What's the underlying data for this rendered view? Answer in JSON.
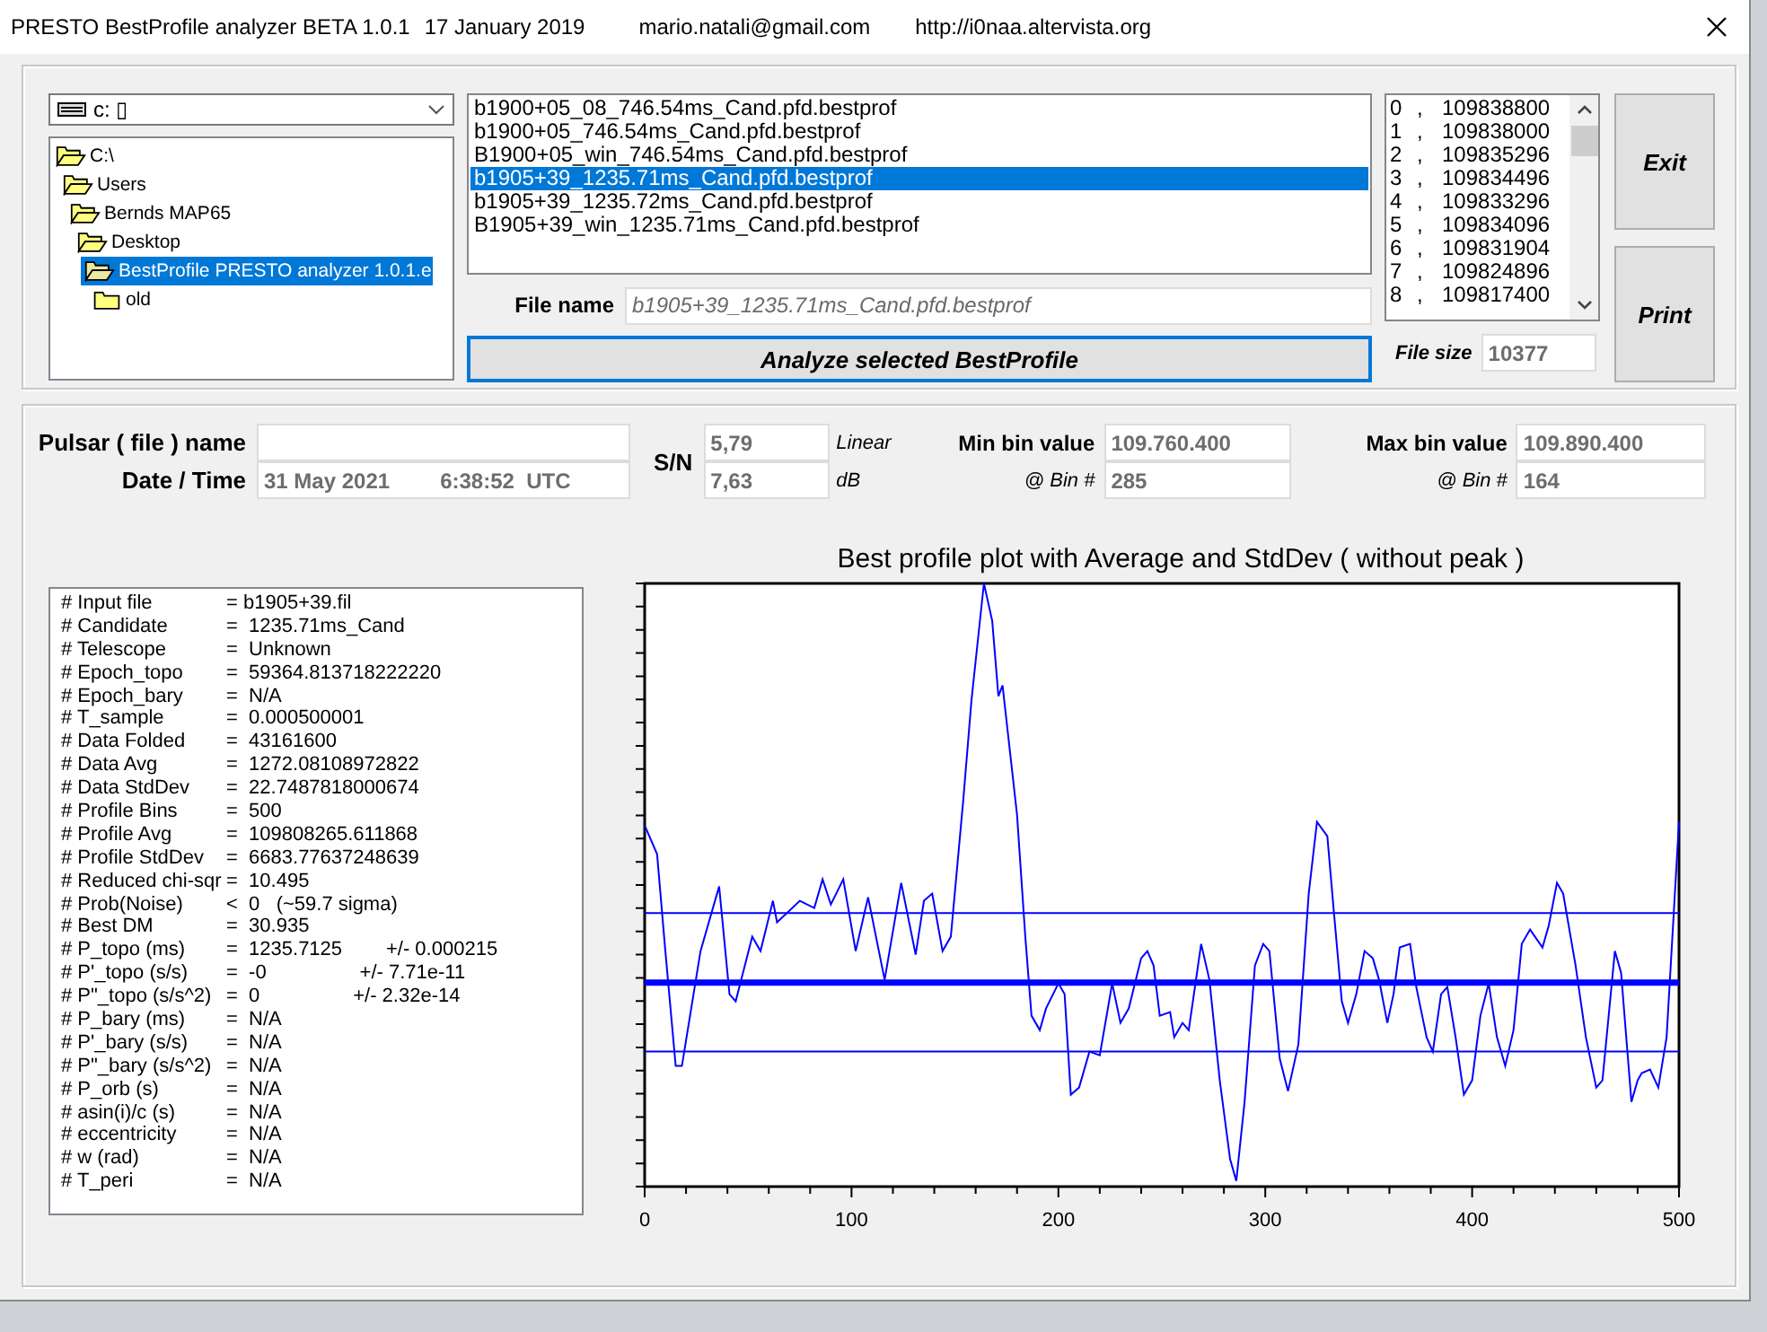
{
  "window": {
    "title": "PRESTO BestProfile analyzer BETA 1.0.1",
    "date": "17 January 2019",
    "email": "mario.natali@gmail.com",
    "url": "http://i0naa.altervista.org"
  },
  "drive_combo": {
    "value": "c: ▯"
  },
  "folder_tree": [
    {
      "label": "C:\\",
      "expanded": true,
      "selected": false,
      "children": [
        {
          "label": "Users",
          "expanded": true,
          "selected": false,
          "children": [
            {
              "label": "Bernds MAP65",
              "expanded": true,
              "selected": false,
              "children": [
                {
                  "label": "Desktop",
                  "expanded": true,
                  "selected": false,
                  "children": [
                    {
                      "label": "BestProfile PRESTO analyzer 1.0.1.e",
                      "expanded": true,
                      "selected": true,
                      "children": [
                        {
                          "label": "old",
                          "expanded": false,
                          "selected": false
                        }
                      ]
                    }
                  ]
                }
              ]
            }
          ]
        }
      ]
    }
  ],
  "file_list": [
    {
      "label": "b1900+05_08_746.54ms_Cand.pfd.bestprof",
      "selected": false
    },
    {
      "label": "b1900+05_746.54ms_Cand.pfd.bestprof",
      "selected": false
    },
    {
      "label": "B1900+05_win_746.54ms_Cand.pfd.bestprof",
      "selected": false
    },
    {
      "label": "b1905+39_1235.71ms_Cand.pfd.bestprof",
      "selected": true
    },
    {
      "label": "b1905+39_1235.72ms_Cand.pfd.bestprof",
      "selected": false
    },
    {
      "label": "B1905+39_win_1235.71ms_Cand.pfd.bestprof",
      "selected": false
    }
  ],
  "file_name": {
    "label": "File name",
    "value": "b1905+39_1235.71ms_Cand.pfd.bestprof"
  },
  "analyze_button": {
    "label": "Analyze selected BestProfile"
  },
  "bins_list": [
    {
      "index": "0",
      "sep": ",",
      "value": "109838800"
    },
    {
      "index": "1",
      "sep": ",",
      "value": "109838000"
    },
    {
      "index": "2",
      "sep": ",",
      "value": "109835296"
    },
    {
      "index": "3",
      "sep": ",",
      "value": "109834496"
    },
    {
      "index": "4",
      "sep": ",",
      "value": "109833296"
    },
    {
      "index": "5",
      "sep": ",",
      "value": "109834096"
    },
    {
      "index": "6",
      "sep": ",",
      "value": "109831904"
    },
    {
      "index": "7",
      "sep": ",",
      "value": "109824896"
    },
    {
      "index": "8",
      "sep": ",",
      "value": "109817400"
    }
  ],
  "file_size": {
    "label": "File size",
    "value": "10377"
  },
  "buttons": [
    {
      "label": "Exit"
    },
    {
      "label": "Print"
    }
  ],
  "pulsar": {
    "name_label": "Pulsar ( file ) name",
    "datetime_label": "Date / Time",
    "date": "31 May 2021",
    "time": "6:38:52  UTC"
  },
  "sn": {
    "label": "S/N",
    "linear": "5,79",
    "linear_unit": "Linear",
    "db": "7,63",
    "db_unit": "dB"
  },
  "min_bin": {
    "label": "Min bin value",
    "value": "109.760.400",
    "bin_label": "@ Bin #",
    "bin": "285"
  },
  "max_bin": {
    "label": "Max bin value",
    "value": "109.890.400",
    "bin_label": "@ Bin #",
    "bin": "164"
  },
  "header_lines": [
    [
      "# Input file",
      "= b1905+39.fil"
    ],
    [
      "# Candidate",
      "=  1235.71ms_Cand"
    ],
    [
      "# Telescope",
      "=  Unknown"
    ],
    [
      "# Epoch_topo",
      "=  59364.813718222220"
    ],
    [
      "# Epoch_bary",
      "=  N/A"
    ],
    [
      "# T_sample",
      "=  0.000500001"
    ],
    [
      "# Data Folded",
      "=  43161600"
    ],
    [
      "# Data Avg",
      "=  1272.08108972822"
    ],
    [
      "# Data StdDev",
      "=  22.7487818000674"
    ],
    [
      "# Profile Bins",
      "=  500"
    ],
    [
      "# Profile Avg",
      "=  109808265.611868"
    ],
    [
      "# Profile StdDev",
      "=  6683.77637248639"
    ],
    [
      "# Reduced chi-sqr",
      "=  10.495"
    ],
    [
      "# Prob(Noise)",
      "<  0   (~59.7 sigma)"
    ],
    [
      "# Best DM",
      "=  30.935"
    ],
    [
      "# P_topo (ms)",
      "=  1235.7125        +/- 0.000215"
    ],
    [
      "# P'_topo (s/s)",
      "=  -0                 +/- 7.71e-11"
    ],
    [
      "# P\"_topo (s/s^2)",
      "=  0                 +/- 2.32e-14"
    ],
    [
      "# P_bary (ms)",
      "=  N/A"
    ],
    [
      "# P'_bary (s/s)",
      "=  N/A"
    ],
    [
      "# P\"_bary (s/s^2)",
      "=  N/A"
    ],
    [
      "# P_orb (s)",
      "=  N/A"
    ],
    [
      "# asin(i)/c (s)",
      "=  N/A"
    ],
    [
      "# eccentricity",
      "=  N/A"
    ],
    [
      "# w (rad)",
      "=  N/A"
    ],
    [
      "# T_peri",
      "=  N/A"
    ]
  ],
  "plot": {
    "title": "Best profile plot with  Average and StdDev ( without peak )",
    "x_tick_labels": [
      "0",
      "100",
      "200",
      "300",
      "400",
      "500"
    ]
  }
}
